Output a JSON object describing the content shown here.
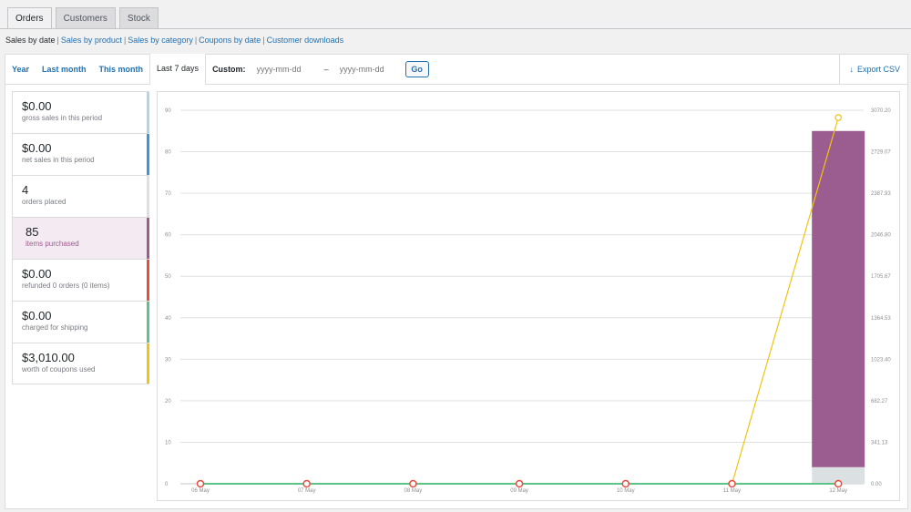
{
  "top_tabs": {
    "orders": "Orders",
    "customers": "Customers",
    "stock": "Stock"
  },
  "subnav": {
    "sales_by_date": "Sales by date",
    "sales_by_product": "Sales by product",
    "sales_by_category": "Sales by category",
    "coupons_by_date": "Coupons by date",
    "customer_downloads": "Customer downloads",
    "separator": "|"
  },
  "ranges": {
    "year": "Year",
    "last_month": "Last month",
    "this_month": "This month",
    "last_7_days": "Last 7 days",
    "custom_label": "Custom:",
    "start_placeholder": "yyyy-mm-dd",
    "dash": "–",
    "end_placeholder": "yyyy-mm-dd",
    "go": "Go"
  },
  "export": {
    "label": "Export CSV",
    "icon": "download-icon"
  },
  "legend": [
    {
      "value": "$0.00",
      "label": "gross sales in this period",
      "color": "#b1d4ea"
    },
    {
      "value": "$0.00",
      "label": "net sales in this period",
      "color": "#3498db"
    },
    {
      "value": "4",
      "label": "orders placed",
      "color": "#dbe1e3"
    },
    {
      "value": "85",
      "label": "items purchased",
      "color": "#9b5c8f"
    },
    {
      "value": "$0.00",
      "label": "refunded 0 orders (0 items)",
      "color": "#e74c3c"
    },
    {
      "value": "$0.00",
      "label": "charged for shipping",
      "color": "#5cc488"
    },
    {
      "value": "$3,010.00",
      "label": "worth of coupons used",
      "color": "#f1c40f"
    }
  ],
  "chart_data": {
    "type": "bar",
    "categories": [
      "06 May",
      "07 May",
      "08 May",
      "09 May",
      "10 May",
      "11 May",
      "12 May"
    ],
    "ylim": [
      0,
      90
    ],
    "y_ticks": [
      "0",
      "10",
      "20",
      "30",
      "40",
      "50",
      "60",
      "70",
      "80",
      "90"
    ],
    "y2lim": [
      0,
      3070.2
    ],
    "y2_ticks": [
      "0.00",
      "341.13",
      "682.27",
      "1023.40",
      "1364.53",
      "1705.67",
      "2046.80",
      "2387.93",
      "2729.07",
      "3070.20"
    ],
    "grid": true,
    "series": [
      {
        "name": "items purchased",
        "kind": "bar",
        "axis": "left",
        "color": "#9b5c8f",
        "values": [
          0,
          0,
          0,
          0,
          0,
          0,
          85
        ]
      },
      {
        "name": "orders placed",
        "kind": "bar",
        "axis": "left",
        "color": "#dbe1e3",
        "values": [
          0,
          0,
          0,
          0,
          0,
          0,
          4
        ]
      },
      {
        "name": "worth of coupons used",
        "kind": "line",
        "axis": "right",
        "color": "#f1c40f",
        "values": [
          0,
          0,
          0,
          0,
          0,
          0,
          3010
        ]
      },
      {
        "name": "gross sales in this period",
        "kind": "line",
        "axis": "right",
        "color": "#b1d4ea",
        "values": [
          0,
          0,
          0,
          0,
          0,
          0,
          0
        ]
      },
      {
        "name": "net sales in this period",
        "kind": "line",
        "axis": "right",
        "color": "#3498db",
        "values": [
          0,
          0,
          0,
          0,
          0,
          0,
          0
        ]
      },
      {
        "name": "refunded 0 orders (0 items)",
        "kind": "line",
        "axis": "right",
        "color": "#e74c3c",
        "values": [
          0,
          0,
          0,
          0,
          0,
          0,
          0
        ]
      },
      {
        "name": "charged for shipping",
        "kind": "line",
        "axis": "right",
        "color": "#5cc488",
        "values": [
          0,
          0,
          0,
          0,
          0,
          0,
          0
        ]
      }
    ]
  }
}
